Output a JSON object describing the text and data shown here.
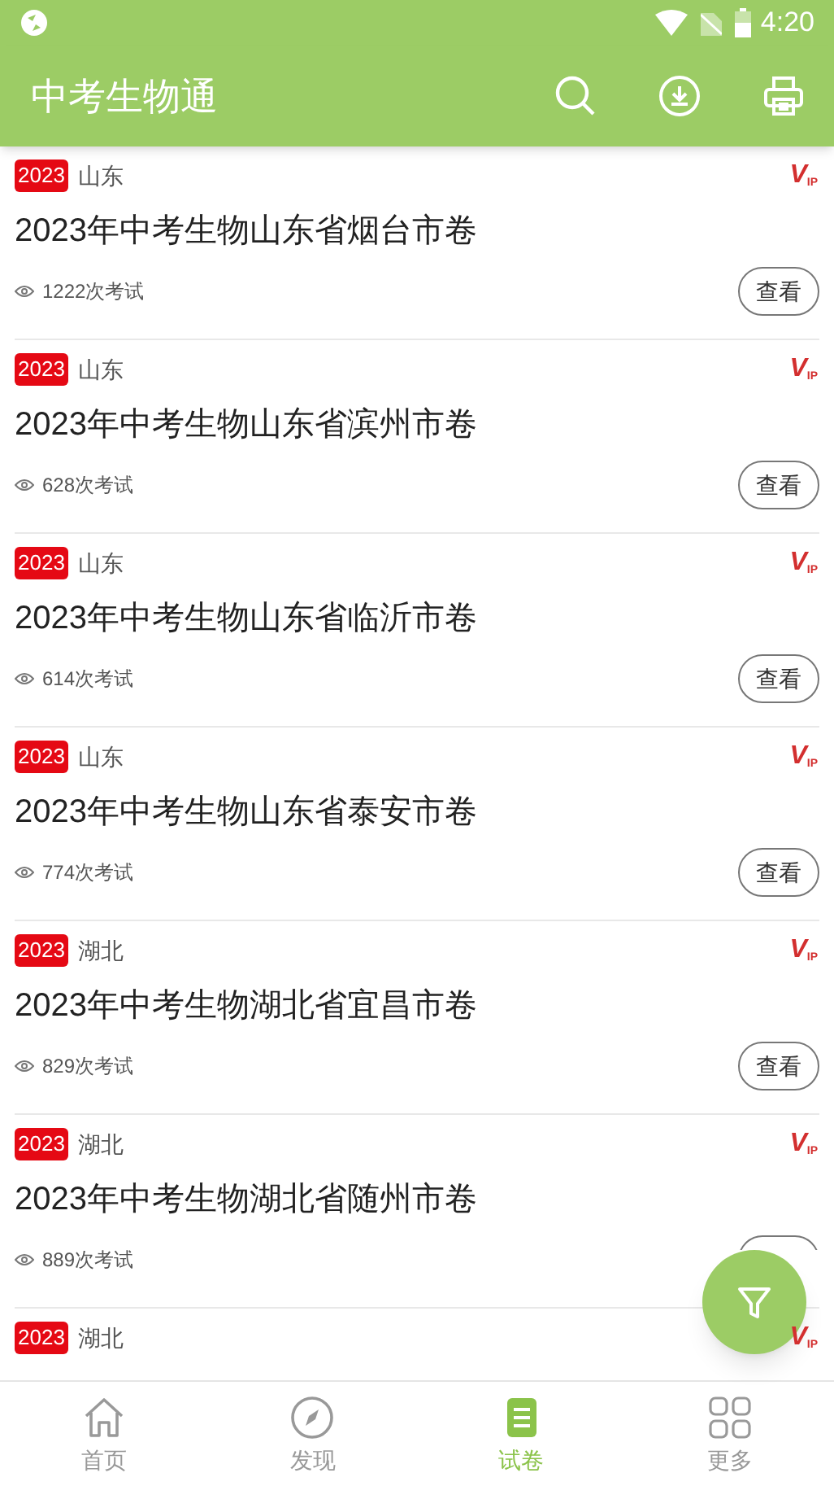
{
  "status_bar": {
    "time": "4:20"
  },
  "app_bar": {
    "title": "中考生物通"
  },
  "papers": [
    {
      "year": "2023",
      "region": "山东",
      "vip": [
        "V",
        "IP"
      ],
      "title": "2023年中考生物山东省烟台市卷",
      "views": "1222次考试",
      "button": "查看"
    },
    {
      "year": "2023",
      "region": "山东",
      "vip": [
        "V",
        "IP"
      ],
      "title": "2023年中考生物山东省滨州市卷",
      "views": "628次考试",
      "button": "查看"
    },
    {
      "year": "2023",
      "region": "山东",
      "vip": [
        "V",
        "IP"
      ],
      "title": "2023年中考生物山东省临沂市卷",
      "views": "614次考试",
      "button": "查看"
    },
    {
      "year": "2023",
      "region": "山东",
      "vip": [
        "V",
        "IP"
      ],
      "title": "2023年中考生物山东省泰安市卷",
      "views": "774次考试",
      "button": "查看"
    },
    {
      "year": "2023",
      "region": "湖北",
      "vip": [
        "V",
        "IP"
      ],
      "title": "2023年中考生物湖北省宜昌市卷",
      "views": "829次考试",
      "button": "查看"
    },
    {
      "year": "2023",
      "region": "湖北",
      "vip": [
        "V",
        "IP"
      ],
      "title": "2023年中考生物湖北省随州市卷",
      "views": "889次考试"
    },
    {
      "year": "2023",
      "region": "湖北",
      "vip": [
        "V",
        "IP"
      ]
    }
  ],
  "bottom_nav": [
    {
      "kind": "home",
      "label": "首页",
      "selected": false
    },
    {
      "kind": "discover",
      "label": "发现",
      "selected": false
    },
    {
      "kind": "papers",
      "label": "试卷",
      "selected": true
    },
    {
      "kind": "more",
      "label": "更多",
      "selected": false
    }
  ]
}
